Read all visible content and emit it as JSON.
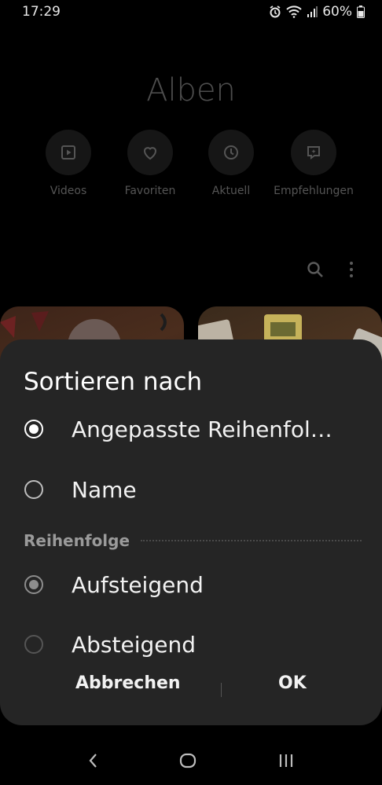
{
  "status": {
    "time": "17:29",
    "battery": "60%"
  },
  "gallery": {
    "title": "Alben",
    "quick_items": [
      {
        "label": "Videos",
        "icon": "video-icon"
      },
      {
        "label": "Favoriten",
        "icon": "heart-icon"
      },
      {
        "label": "Aktuell",
        "icon": "clock-icon"
      },
      {
        "label": "Empfehlungen",
        "icon": "suggestion-icon"
      }
    ]
  },
  "dialog": {
    "title": "Sortieren nach",
    "sort_options": [
      {
        "label": "Angepasste Reihenfol…",
        "selected": true
      },
      {
        "label": "Name",
        "selected": false
      }
    ],
    "order_section_title": "Reihenfolge",
    "order_options": [
      {
        "label": "Aufsteigend",
        "selected": true,
        "enabled": false
      },
      {
        "label": "Absteigend",
        "selected": false,
        "enabled": false
      }
    ],
    "cancel_label": "Abbrechen",
    "ok_label": "OK"
  },
  "colors": {
    "sheet_bg": "#252525",
    "background": "#000000",
    "text": "#f2f2f2"
  }
}
